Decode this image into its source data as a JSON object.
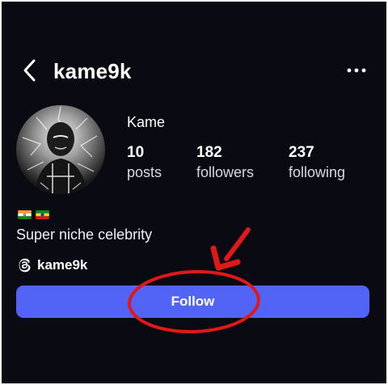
{
  "header": {
    "back_icon": "chevron-left-icon",
    "username": "kame9k",
    "more_icon": "more-horizontal-icon"
  },
  "profile": {
    "avatar_alt": "profile avatar",
    "display_name": "Kame",
    "stats": [
      {
        "value": "10",
        "label": "posts"
      },
      {
        "value": "182",
        "label": "followers"
      },
      {
        "value": "237",
        "label": "following"
      }
    ],
    "flags": [
      "india-flag-icon",
      "ethiopia-flag-icon"
    ],
    "bio": "Super niche celebrity",
    "threads": {
      "icon": "threads-icon",
      "handle": "kame9k"
    }
  },
  "actions": {
    "follow_label": "Follow"
  },
  "annotation": {
    "arrow_color": "#e01818",
    "circle_color": "#e01818"
  },
  "colors": {
    "background": "#0a0a12",
    "follow_button": "#5264f5",
    "text": "#ffffff"
  }
}
